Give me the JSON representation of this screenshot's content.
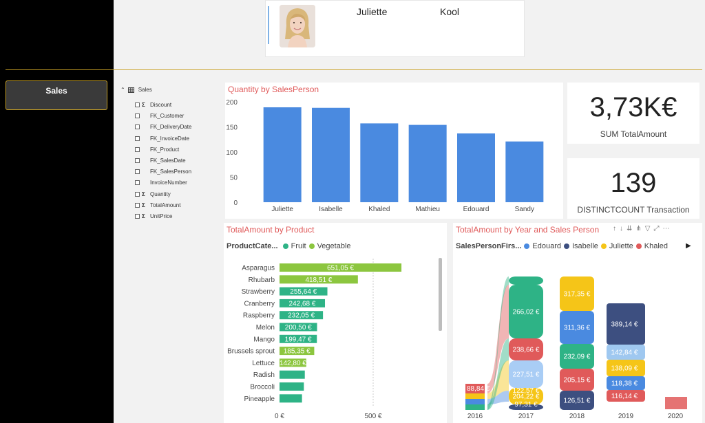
{
  "profile": {
    "first_name": "Juliette",
    "last_name": "Kool"
  },
  "nav": {
    "sales_label": "Sales"
  },
  "field_list": {
    "table_name": "Sales",
    "fields": [
      {
        "name": "Discount",
        "sigma": true
      },
      {
        "name": "FK_Customer",
        "sigma": false
      },
      {
        "name": "FK_DeliveryDate",
        "sigma": false
      },
      {
        "name": "FK_InvoiceDate",
        "sigma": false
      },
      {
        "name": "FK_Product",
        "sigma": false
      },
      {
        "name": "FK_SalesDate",
        "sigma": false
      },
      {
        "name": "FK_SalesPerson",
        "sigma": false
      },
      {
        "name": "InvoiceNumber",
        "sigma": false
      },
      {
        "name": "Quantity",
        "sigma": true
      },
      {
        "name": "TotalAmount",
        "sigma": true
      },
      {
        "name": "UnitPrice",
        "sigma": true
      }
    ],
    "sigma_glyph": "Σ"
  },
  "cards": {
    "total_amount": {
      "value": "3,73K€",
      "label": "SUM TotalAmount"
    },
    "transactions": {
      "value": "139",
      "label": "DISTINCTCOUNT Transaction"
    }
  },
  "colors": {
    "bar_blue": "#4a8ae0",
    "fruit": "#2eb386",
    "vegetable": "#8cc63f",
    "edouard": "#4a8ae0",
    "isabelle": "#3d4f80",
    "juliette": "#f5c518",
    "khaled": "#e05a5a",
    "title_red": "#e05a5a"
  },
  "header_icons": [
    "↑",
    "↓",
    "⇊",
    "⋔",
    "▽",
    "⤢",
    "⋯"
  ],
  "chart_data": [
    {
      "type": "bar",
      "title": "Quantity by SalesPerson",
      "categories": [
        "Juliette",
        "Isabelle",
        "Khaled",
        "Mathieu",
        "Edouard",
        "Sandy"
      ],
      "values": [
        189,
        188,
        157,
        154,
        137,
        121
      ],
      "y_ticks": [
        "0",
        "50",
        "100",
        "150",
        "200"
      ],
      "ylim": [
        0,
        200
      ]
    },
    {
      "type": "bar",
      "orientation": "horizontal",
      "title": "TotalAmount by Product",
      "legend_title": "ProductCate...",
      "legend": [
        "Fruit",
        "Vegetable"
      ],
      "categories": [
        "Asparagus",
        "Rhubarb",
        "Strawberry",
        "Cranberry",
        "Raspberry",
        "Melon",
        "Mango",
        "Brussels sprout",
        "Lettuce",
        "Radish",
        "Broccoli",
        "Pineapple"
      ],
      "values": [
        651.05,
        418.51,
        255.64,
        242.68,
        232.05,
        200.5,
        199.47,
        185.35,
        142.8,
        135,
        130,
        120
      ],
      "labels": [
        "651,05 €",
        "418,51 €",
        "255,64 €",
        "242,68 €",
        "232,05 €",
        "200,50 €",
        "199,47 €",
        "185,35 €",
        "142,80 €",
        "",
        "",
        ""
      ],
      "category_type": [
        "Vegetable",
        "Vegetable",
        "Fruit",
        "Fruit",
        "Fruit",
        "Fruit",
        "Fruit",
        "Vegetable",
        "Vegetable",
        "Fruit",
        "Fruit",
        "Fruit"
      ],
      "x_ticks": [
        "0 €",
        "500 €"
      ],
      "xlim": [
        0,
        700
      ]
    },
    {
      "type": "area",
      "subtype": "ribbon",
      "title": "TotalAmount by Year and Sales Person",
      "legend_title": "SalesPersonFirs...",
      "legend": [
        "Edouard",
        "Isabelle",
        "Juliette",
        "Khaled"
      ],
      "x": [
        "2016",
        "2017",
        "2018",
        "2019",
        "2020"
      ],
      "series": [
        {
          "name": "Edouard",
          "values": [
            null,
            227.51,
            311.36,
            118.38,
            null
          ]
        },
        {
          "name": "Isabelle",
          "values": [
            null,
            122.57,
            126.51,
            389.14,
            null
          ]
        },
        {
          "name": "Juliette",
          "values": [
            null,
            204.22,
            317.35,
            138.09,
            null
          ]
        },
        {
          "name": "Khaled",
          "values": [
            88.84,
            238.66,
            205.15,
            116.14,
            null
          ]
        }
      ],
      "extra_labels": [
        "266,02 €",
        "97,31 €",
        "232,09 €",
        "142,84 €"
      ],
      "labels": {
        "k2016": "88,84 €",
        "e2017": "227,51 €",
        "i2017": "122,57 €",
        "j2017": "204,22 €",
        "k2017": "238,66 €",
        "g2017": "266,02 €",
        "b2017": "97,31 €",
        "e2018": "311,36 €",
        "i2018": "126,51 €",
        "j2018": "317,35 €",
        "k2018": "205,15 €",
        "g2018": "232,09 €",
        "e2019": "118,38 €",
        "i2019": "389,14 €",
        "j2019": "138,09 €",
        "k2019": "116,14 €",
        "w2019": "142,84 €"
      }
    }
  ]
}
